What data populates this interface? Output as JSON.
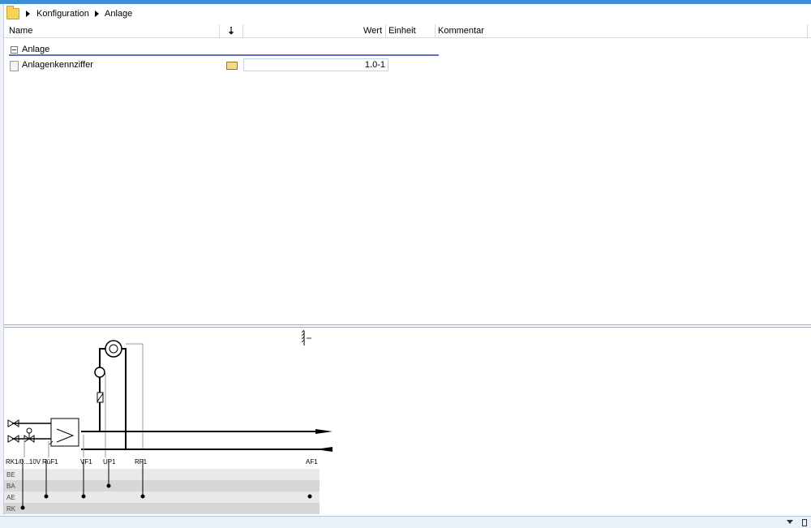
{
  "breadcrumb": {
    "items": [
      "Konfiguration",
      "Anlage"
    ]
  },
  "table": {
    "columns": {
      "name": "Name",
      "wert": "Wert",
      "einheit": "Einheit",
      "kommentar": "Kommentar"
    },
    "group": "Anlage",
    "rows": [
      {
        "name": "Anlagenkennziffer",
        "wert": "1.0-1"
      }
    ]
  },
  "diagram": {
    "labels": {
      "rk_valve": "RK1/0...10V",
      "ruf": "RüF1",
      "vf": "VF1",
      "up": "UP1",
      "rf": "RF1",
      "af": "AF1"
    },
    "rows": [
      "BE",
      "BA",
      "AE",
      "RK"
    ],
    "row_colors": [
      "#e9e9e9",
      "#d6d6d6",
      "#e9e9e9",
      "#d6d6d6"
    ]
  }
}
